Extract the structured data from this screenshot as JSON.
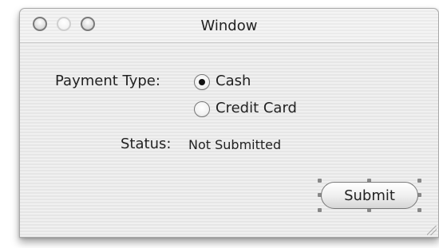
{
  "window": {
    "title": "Window",
    "controls": [
      "close-icon",
      "minimize-icon",
      "zoom-icon"
    ]
  },
  "form": {
    "payment_type_label": "Payment Type:",
    "options": [
      {
        "label": "Cash",
        "checked": true
      },
      {
        "label": "Credit Card",
        "checked": false
      }
    ],
    "status_label": "Status:",
    "status_value": "Not Submitted",
    "submit_label": "Submit"
  }
}
